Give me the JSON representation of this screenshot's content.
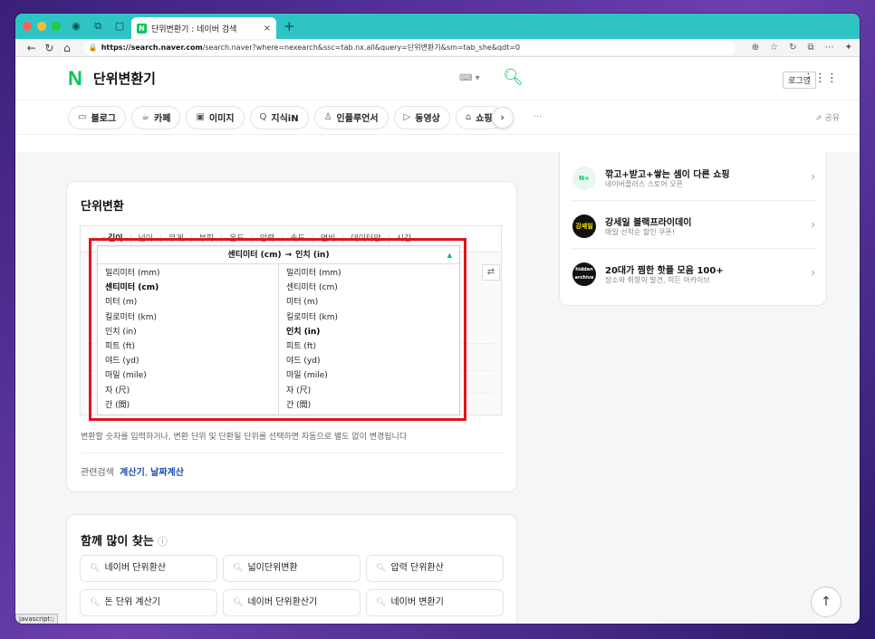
{
  "browser": {
    "tab_title": "단위변환기 : 네이버 검색",
    "tab_favicon": "N",
    "new_tab": "+",
    "url_host": "https://search.naver.com",
    "url_path": "/search.naver?where=nexearch&ssc=tab.nx.all&query=단위변환기&sm=tab_she&qdt=0"
  },
  "header": {
    "logo": "N",
    "title": "단위변환기",
    "login": "로그인"
  },
  "chips": [
    {
      "icon": "▭",
      "label": "블로그"
    },
    {
      "icon": "☕",
      "label": "카페"
    },
    {
      "icon": "▣",
      "label": "이미지"
    },
    {
      "icon": "Q",
      "label": "지식iN"
    },
    {
      "icon": "♙",
      "label": "인플루언서"
    },
    {
      "icon": "▷",
      "label": "동영상"
    },
    {
      "icon": "⌂",
      "label": "쇼핑"
    }
  ],
  "chip_more": "···",
  "share": "공유",
  "converter": {
    "title": "단위변환",
    "tabs": [
      "길이",
      "넓이",
      "무게",
      "부피",
      "온도",
      "압력",
      "속도",
      "연비",
      "데이터양",
      "시간"
    ],
    "from_unit": "센티미터 (cm)",
    "to_unit": "인치 (in)",
    "from_options": [
      "밀리미터 (mm)",
      "센티미터 (cm)",
      "미터 (m)",
      "킬로미터 (km)",
      "인치 (in)",
      "피트 (ft)",
      "야드 (yd)",
      "마일 (mile)",
      "자 (尺)",
      "간 (間)"
    ],
    "to_options": [
      "밀리미터 (mm)",
      "센티미터 (cm)",
      "미터 (m)",
      "킬로미터 (km)",
      "인치 (in)",
      "피트 (ft)",
      "야드 (yd)",
      "마일 (mile)",
      "자 (尺)",
      "간 (間)"
    ],
    "selected_from": 1,
    "selected_to": 4,
    "note": "변환할 숫자를 입력하거나, 변환 단위 및 단환될 단위를 선택하면 자동으로 별도 없이 변경됩니다",
    "related_label": "관련검색",
    "related_links": [
      "계산기",
      "날짜계산"
    ]
  },
  "sidebar": {
    "items": [
      {
        "icon_text": "N+",
        "title": "깎고+받고+쌓는 셈이 다른 쇼핑",
        "sub": "네이버플러스 스토어 오픈",
        "bg": "#e8f8ee",
        "fg": "#03c75a"
      },
      {
        "icon_text": "강세일",
        "title": "강세일 블랙프라이데이",
        "sub": "매일 선착순 할인 쿠폰!",
        "bg": "#111111",
        "fg": "#ffe000"
      },
      {
        "icon_text": "hidden archive",
        "title": "20대가 찜한 핫플 모음 100+",
        "sub": "장소와 취향의 발견, 히든 아카이브",
        "bg": "#111111",
        "fg": "#ffffff"
      }
    ]
  },
  "popular": {
    "title": "함께 많이 찾는",
    "items": [
      "네이버 단위환산",
      "넓이단위변환",
      "압력 단위환산",
      "돈 단위 계산기",
      "네이버 단위환산기",
      "네이버 변환기"
    ]
  },
  "status_text": "javascript:;",
  "colors": {
    "naver_green": "#03c75a",
    "highlight_red": "#e0141e",
    "link_blue": "#1b4fb3"
  }
}
